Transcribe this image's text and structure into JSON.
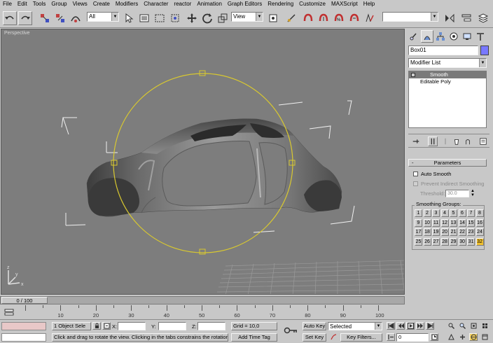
{
  "menu": [
    "File",
    "Edit",
    "Tools",
    "Group",
    "Views",
    "Create",
    "Modifiers",
    "Character",
    "reactor",
    "Animation",
    "Graph Editors",
    "Rendering",
    "Customize",
    "MAXScript",
    "Help"
  ],
  "toolbar": {
    "selection_filter": "All",
    "ref_coord": "View",
    "named_selection": ""
  },
  "viewport": {
    "label": "Perspective",
    "axis_x": "x",
    "axis_y": "y",
    "axis_z": "z"
  },
  "command_panel": {
    "object_name": "Box01",
    "object_color": "#7878ff",
    "modifier_list": "Modifier List",
    "stack": [
      {
        "label": "Smooth",
        "selected": true
      },
      {
        "label": "Editable Poly",
        "selected": false
      }
    ],
    "rollout_title": "Parameters",
    "rollout_collapse": "-",
    "auto_smooth": "Auto Smooth",
    "prevent_indirect": "Prevent Indirect Smoothing",
    "threshold_label": "Threshold:",
    "threshold_value": "30.0",
    "smoothing_groups_title": "Smoothing Groups:",
    "smoothing_groups": [
      "1",
      "2",
      "3",
      "4",
      "5",
      "6",
      "7",
      "8",
      "9",
      "10",
      "11",
      "12",
      "13",
      "14",
      "15",
      "16",
      "17",
      "18",
      "19",
      "20",
      "21",
      "22",
      "23",
      "24",
      "25",
      "26",
      "27",
      "28",
      "29",
      "30",
      "31",
      "32"
    ],
    "active_group": "32"
  },
  "timeline": {
    "slider_label": "0 / 100",
    "ticks": [
      "10",
      "20",
      "30",
      "40",
      "50",
      "60",
      "70",
      "80",
      "90",
      "100"
    ]
  },
  "status": {
    "selection_count": "1 Object Sele",
    "x_label": "X:",
    "y_label": "Y:",
    "z_label": "Z:",
    "x_value": "",
    "y_value": "",
    "z_value": "",
    "grid": "Grid = 10,0",
    "prompt": "Click and drag to rotate the view.  Clicking in the tabs constrains the rotation",
    "add_time_tag": "Add Time Tag",
    "auto_key": "Auto Key",
    "set_key": "Set Key",
    "key_mode": "Selected",
    "key_filters": "Key Filters...",
    "frame": "0"
  },
  "colors": {
    "viewport_bg": "#7d7d7d",
    "gizmo": "#d8c830",
    "active_group": "#f2c230"
  }
}
